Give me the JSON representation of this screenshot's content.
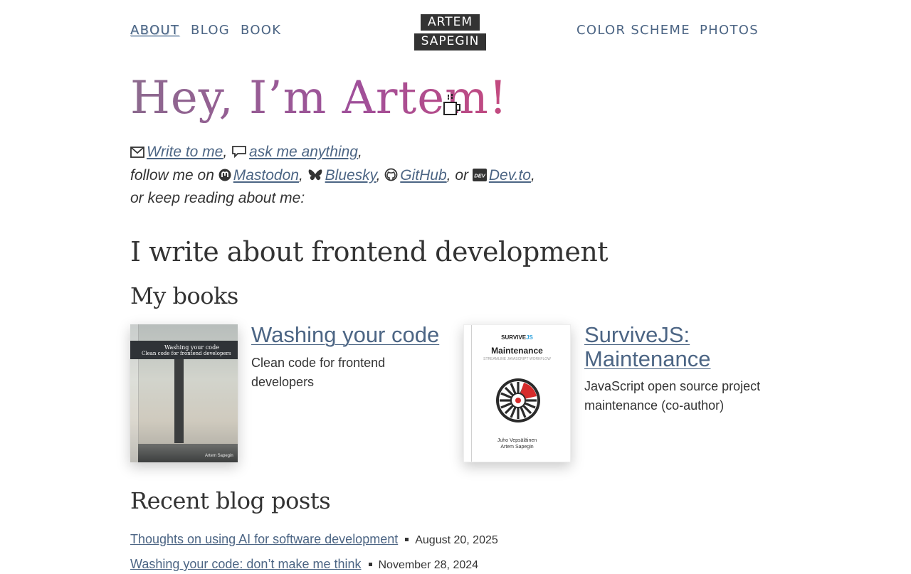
{
  "header": {
    "nav_left": [
      "ABOUT",
      "BLOG",
      "BOOK"
    ],
    "nav_right": [
      "COLOR SCHEME",
      "PHOTOS"
    ],
    "logo_line1": "ARTEM",
    "logo_line2": "SAPEGIN"
  },
  "hero": {
    "title": "Hey, I’m Artem!",
    "icon": "coffee-icon"
  },
  "intro": {
    "write_link": "Write to me",
    "sep1": ",",
    "ask_link": "ask me anything",
    "sep2": ",",
    "follow_text": "follow me on",
    "mastodon": "Mastodon",
    "bluesky": "Bluesky",
    "github": "GitHub",
    "or_text": ", or",
    "devto": "Dev.to",
    "closing": "or keep reading about me:",
    "icons": [
      "mail-icon",
      "chat-icon",
      "mastodon-icon",
      "bluesky-icon",
      "github-icon",
      "devto-icon"
    ]
  },
  "section_title": "I write about frontend development",
  "books": {
    "heading": "My books",
    "items": [
      {
        "title": "Washing your code",
        "description": "Clean code for frontend developers",
        "cover_title": "Washing your code",
        "cover_subtitle": "Clean code for frontend developers",
        "cover_author": "Artem Sapegin"
      },
      {
        "title": "SurviveJS: Maintenance",
        "description": "JavaScript open source project maintenance (co-author)",
        "cover_brand_1": "SURVIVE",
        "cover_brand_2": "JS",
        "cover_title": "Maintenance",
        "cover_tagline": "STREAMLINE JAVASCRIPT WORKFLOW",
        "cover_author_1": "Juho Vepsäläinen",
        "cover_author_2": "Artem Sapegin"
      }
    ]
  },
  "posts": {
    "heading": "Recent blog posts",
    "items": [
      {
        "title": "Thoughts on using AI for software development",
        "date": "August 20, 2025"
      },
      {
        "title": "Washing your code: don’t make me think",
        "date": "November 28, 2024"
      }
    ]
  },
  "colors": {
    "link": "#4c6584",
    "text": "#333333",
    "logo_bg": "#333333",
    "title_gradient_start": "#8c6a8e",
    "title_gradient_end": "#c4497e"
  }
}
